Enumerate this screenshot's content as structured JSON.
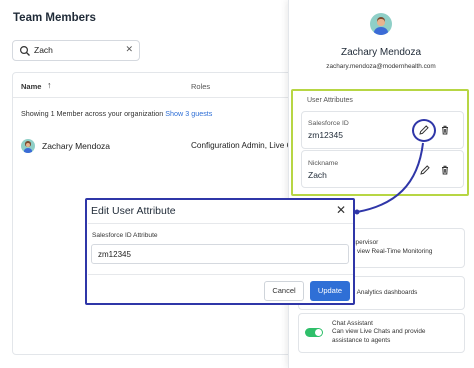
{
  "main": {
    "title": "Team Members",
    "search": {
      "value": "Zach",
      "clear_icon": "close-icon"
    },
    "table": {
      "columns": [
        "Name",
        "Roles"
      ],
      "sort_icon": "arrow-up-icon",
      "summary": "Showing 1 Member across your organization",
      "guests_link": "Show 3 guests",
      "rows": [
        {
          "name": "Zachary Mendoza",
          "roles": "Configuration Admin, Live Ch"
        }
      ]
    }
  },
  "drawer": {
    "name": "Zachary Mendoza",
    "email": "zachary.mendoza@modernhealth.com",
    "section_label": "User Attributes",
    "attributes": [
      {
        "label": "Salesforce ID",
        "value": "zm12345"
      },
      {
        "label": "Nickname",
        "value": "Zach"
      }
    ],
    "permissions": [
      {
        "text_line1": "upervisor",
        "text_line2": "y view Real-Time Monitoring"
      },
      {
        "text_line1": "y Analytics dashboards",
        "text_line2": ""
      },
      {
        "text_line1": "Chat Assistant",
        "text_line2": "Can view Live Chats and provide",
        "text_line3": "assistance to agents"
      }
    ]
  },
  "modal": {
    "title": "Edit User Attribute",
    "field_label": "Salesforce ID Attribute",
    "field_value": "zm12345",
    "cancel_label": "Cancel",
    "update_label": "Update"
  },
  "colors": {
    "highlight_green": "#b7d644",
    "highlight_blue": "#2f36a8",
    "primary": "#2f6fd6",
    "toggle_on": "#2fbf6a"
  }
}
